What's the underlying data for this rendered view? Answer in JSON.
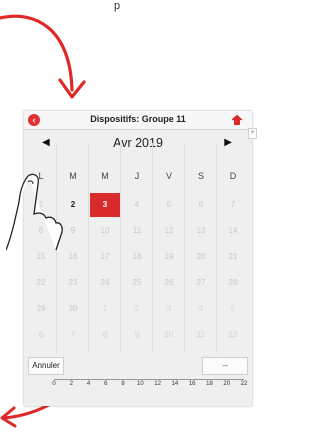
{
  "caption": "p",
  "header": {
    "title": "Dispositifs: Groupe 11",
    "back_icon": "back-icon",
    "home_icon": "home-icon",
    "side_tab_glyph": "×"
  },
  "calendar": {
    "month_label": "Avr 2019",
    "prev_glyph": "◀",
    "next_glyph": "▶",
    "weekdays": [
      "L",
      "M",
      "M",
      "J",
      "V",
      "S",
      "D"
    ],
    "weeks": [
      [
        "1",
        "2",
        "3",
        "4",
        "5",
        "6",
        "7"
      ],
      [
        "8",
        "9",
        "10",
        "11",
        "12",
        "13",
        "14"
      ],
      [
        "15",
        "16",
        "17",
        "18",
        "19",
        "20",
        "21"
      ],
      [
        "22",
        "23",
        "24",
        "25",
        "26",
        "27",
        "28"
      ],
      [
        "29",
        "30",
        "1",
        "2",
        "3",
        "4",
        "5"
      ],
      [
        "6",
        "7",
        "8",
        "9",
        "10",
        "11",
        "12"
      ]
    ],
    "active_days": [
      "2"
    ],
    "selected_day": "3"
  },
  "footer": {
    "cancel_label": "Annuler",
    "ok_label": "--",
    "scale_ticks": [
      "0",
      "2",
      "4",
      "6",
      "8",
      "10",
      "12",
      "14",
      "16",
      "18",
      "20",
      "22"
    ]
  },
  "colors": {
    "accent": "#d92b2b",
    "arrow": "#e02828"
  },
  "icons": {
    "arrows": "curved-arrow-icon",
    "hand": "pointing-hand-icon"
  }
}
